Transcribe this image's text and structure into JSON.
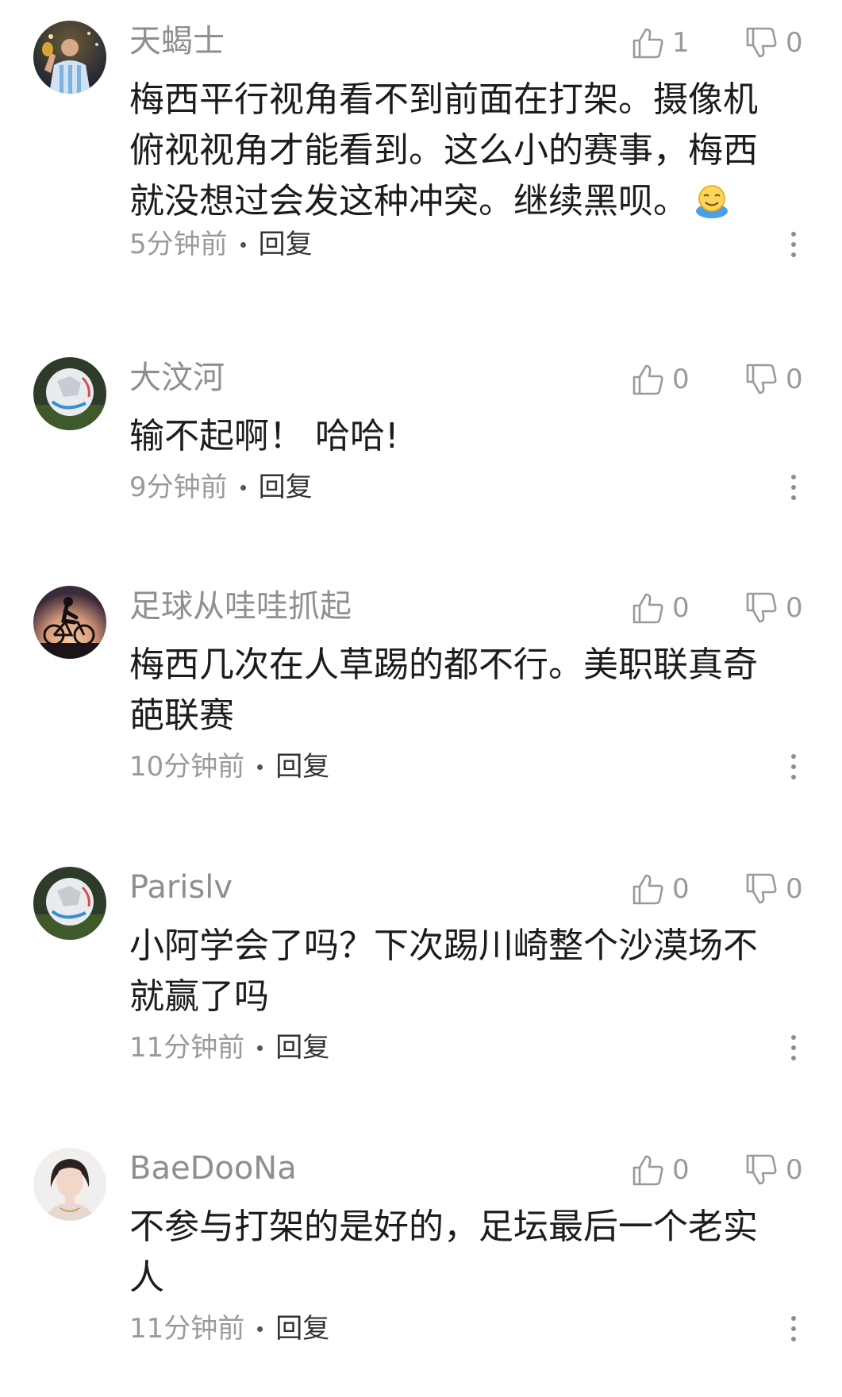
{
  "comments": [
    {
      "username": "天蝎士",
      "text": "梅西平行视角看不到前面在打架。摄像机俯视视角才能看到。这么小的赛事，梅西就没想过会发这种冲突。继续黑呗。",
      "emoji": "smiling-face-emoji",
      "likes": "1",
      "dislikes": "0",
      "time": "5分钟前",
      "reply_label": "回复",
      "avatar": "player-celebrating-avatar"
    },
    {
      "username": "大汶河",
      "text": "输不起啊！ 哈哈!",
      "likes": "0",
      "dislikes": "0",
      "time": "9分钟前",
      "reply_label": "回复",
      "avatar": "football-avatar"
    },
    {
      "username": "足球从哇哇抓起",
      "text": "梅西几次在人草踢的都不行。美职联真奇葩联赛",
      "likes": "0",
      "dislikes": "0",
      "time": "10分钟前",
      "reply_label": "回复",
      "avatar": "cyclist-sunset-avatar"
    },
    {
      "username": "Parislv",
      "text": "小阿学会了吗？下次踢川崎整个沙漠场不就赢了吗",
      "likes": "0",
      "dislikes": "0",
      "time": "11分钟前",
      "reply_label": "回复",
      "avatar": "football-avatar"
    },
    {
      "username": "BaeDooNa",
      "text": "不参与打架的是好的，足坛最后一个老实人",
      "likes": "0",
      "dislikes": "0",
      "time": "11分钟前",
      "reply_label": "回复",
      "avatar": "woman-portrait-avatar"
    }
  ],
  "colors": {
    "username": "#8e8e93",
    "text": "#1c1c1c",
    "meta": "#9a9a9a",
    "icon": "#9a9a9a"
  }
}
